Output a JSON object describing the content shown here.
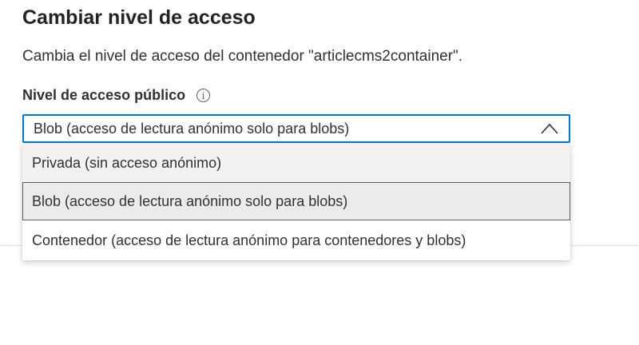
{
  "panel": {
    "title": "Cambiar nivel de acceso",
    "description": "Cambia el nivel de acceso del contenedor \"articlecms2container\"."
  },
  "access_field": {
    "label": "Nivel de acceso público",
    "info_icon": "info-icon",
    "selected_value": "Blob (acceso de lectura anónimo solo para blobs)",
    "dropdown_icon": "chevron-up-icon",
    "options": [
      {
        "label": "Privada (sin acceso anónimo)"
      },
      {
        "label": "Blob (acceso de lectura anónimo solo para blobs)"
      },
      {
        "label": "Contenedor (acceso de lectura anónimo para contenedores y blobs)"
      }
    ]
  },
  "colors": {
    "focus_border": "#0078d4",
    "text": "#323130",
    "option_hover_bg": "#f3f2f1",
    "option_selected_bg": "#edebe9"
  }
}
